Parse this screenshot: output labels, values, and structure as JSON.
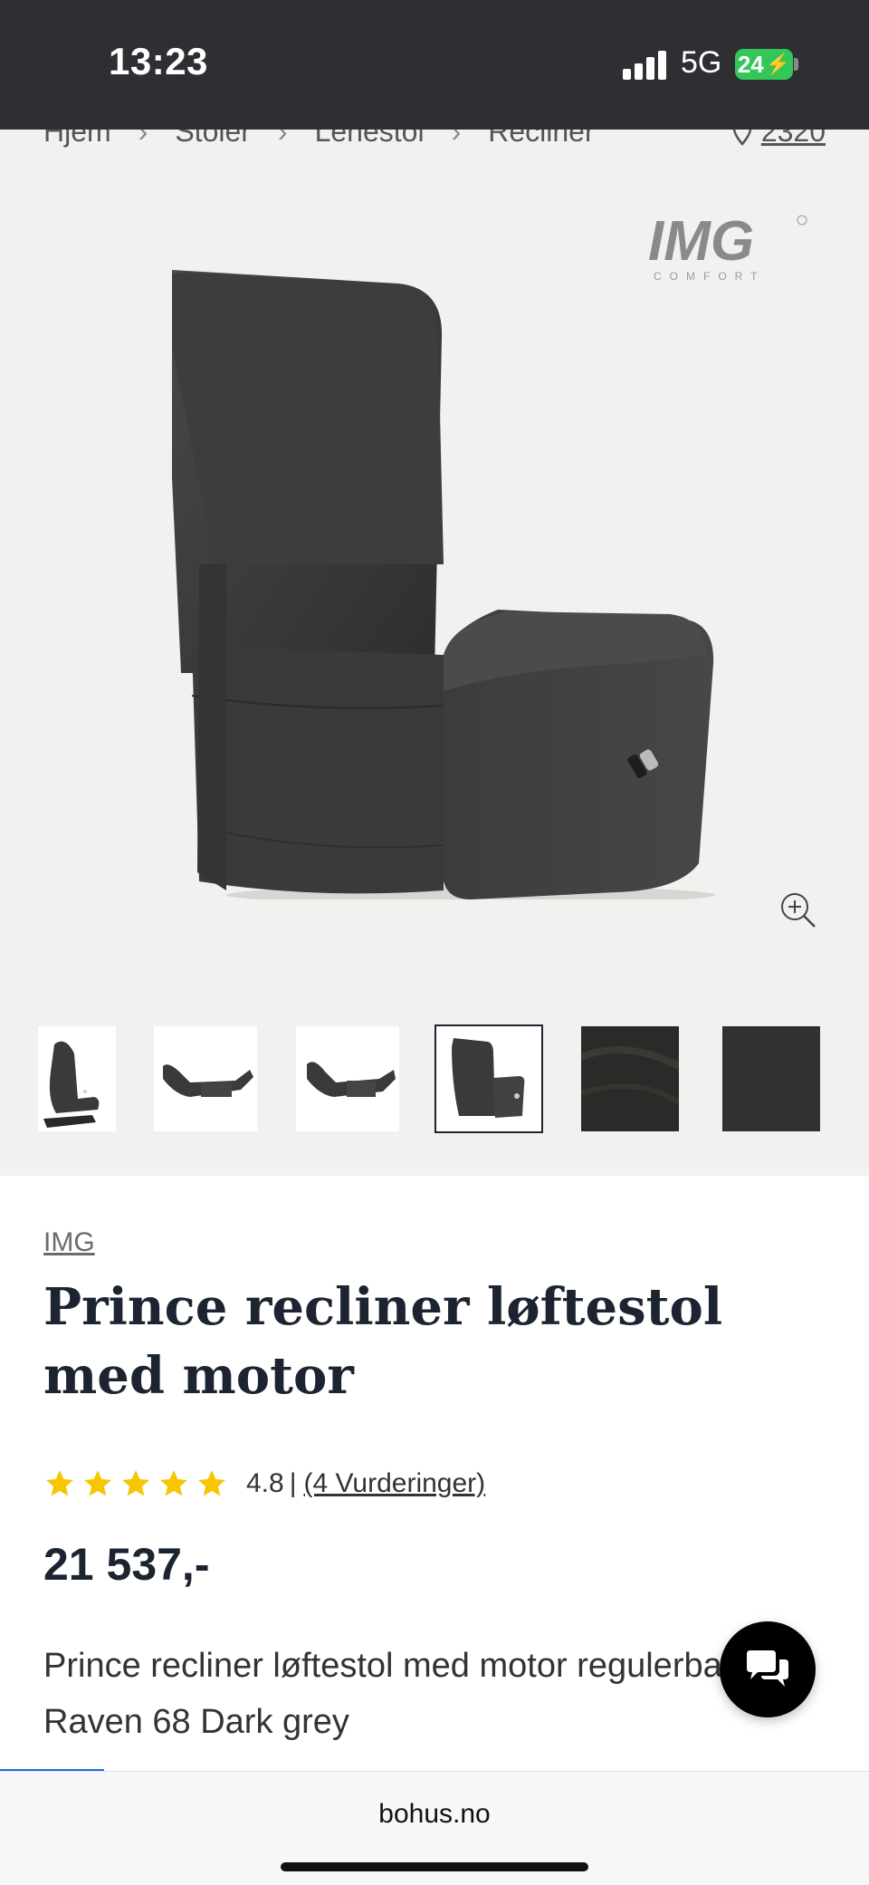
{
  "status_bar": {
    "time": "13:23",
    "network": "5G",
    "battery": "24"
  },
  "breadcrumb": {
    "items": [
      "Hjem",
      "Stoler",
      "Lenestol",
      "Recliner"
    ],
    "location": "2320"
  },
  "gallery": {
    "brand_logo": "IMG",
    "brand_logo_sub": "COMFORT",
    "zoom_icon": "zoom-in-icon",
    "thumbnails": [
      "lift-side",
      "recline-1",
      "recline-2",
      "back-view",
      "fabric-1",
      "fabric-2"
    ],
    "selected_thumbnail": 3
  },
  "product": {
    "brand": "IMG",
    "title": "Prince recliner løftestol med motor",
    "rating_value": "4.8",
    "rating_separator": "|",
    "rating_count": "(4 Vurderinger)",
    "stars": 5,
    "price": "21 537,-",
    "description": "Prince recliner løftestol med motor regulerbar rygg Raven 68 Dark grey"
  },
  "chat": {
    "icon": "chat-bubbles-icon"
  },
  "browser": {
    "url": "bohus.no",
    "load_progress": 0.12
  },
  "colors": {
    "status_bg": "#2e2f33",
    "gallery_bg": "#f2f1ef",
    "text_dark": "#1b2430",
    "star": "#f7c600",
    "battery": "#33c759",
    "progress": "#1e6fdc"
  }
}
